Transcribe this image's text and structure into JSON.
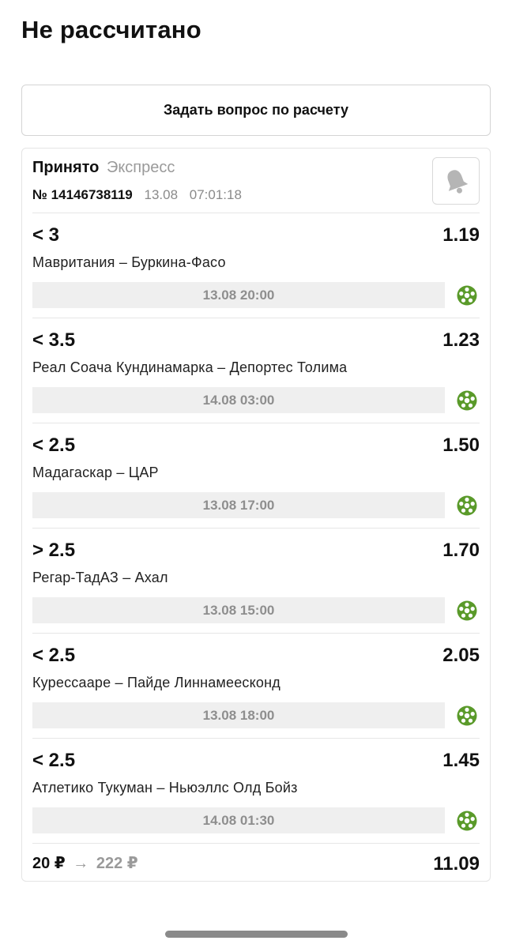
{
  "page": {
    "title": "Не рассчитано"
  },
  "ask_button": {
    "label": "Задать вопрос по расчету"
  },
  "bet": {
    "status": "Принято",
    "type": "Экспресс",
    "ticket_number": "№ 14146738119",
    "date": "13.08",
    "time": "07:01:18",
    "events": [
      {
        "market": "< 3",
        "odds": "1.19",
        "teams": "Мавритания – Буркина-Фасо",
        "datetime": "13.08 20:00",
        "sport_icon": "football-icon"
      },
      {
        "market": "< 3.5",
        "odds": "1.23",
        "teams": "Реал Соача Кундинамарка – Депортес Толима",
        "datetime": "14.08 03:00",
        "sport_icon": "football-icon"
      },
      {
        "market": "< 2.5",
        "odds": "1.50",
        "teams": "Мадагаскар – ЦАР",
        "datetime": "13.08 17:00",
        "sport_icon": "football-icon"
      },
      {
        "market": "> 2.5",
        "odds": "1.70",
        "teams": "Регар-ТадАЗ – Ахал",
        "datetime": "13.08 15:00",
        "sport_icon": "football-icon"
      },
      {
        "market": "< 2.5",
        "odds": "2.05",
        "teams": "Курессааре – Пайде Линнамеесконд",
        "datetime": "13.08 18:00",
        "sport_icon": "football-icon"
      },
      {
        "market": "< 2.5",
        "odds": "1.45",
        "teams": "Атлетико Тукуман – Ньюэллс Олд Бойз",
        "datetime": "14.08 01:30",
        "sport_icon": "football-icon"
      }
    ],
    "stake": "20 ₽",
    "arrow": "→",
    "potential_win": "222 ₽",
    "total_odds": "11.09"
  },
  "colors": {
    "sport_icon": "#5a9a2a",
    "bell_icon": "#b5b5b5",
    "muted_text": "#9a9a9a"
  }
}
